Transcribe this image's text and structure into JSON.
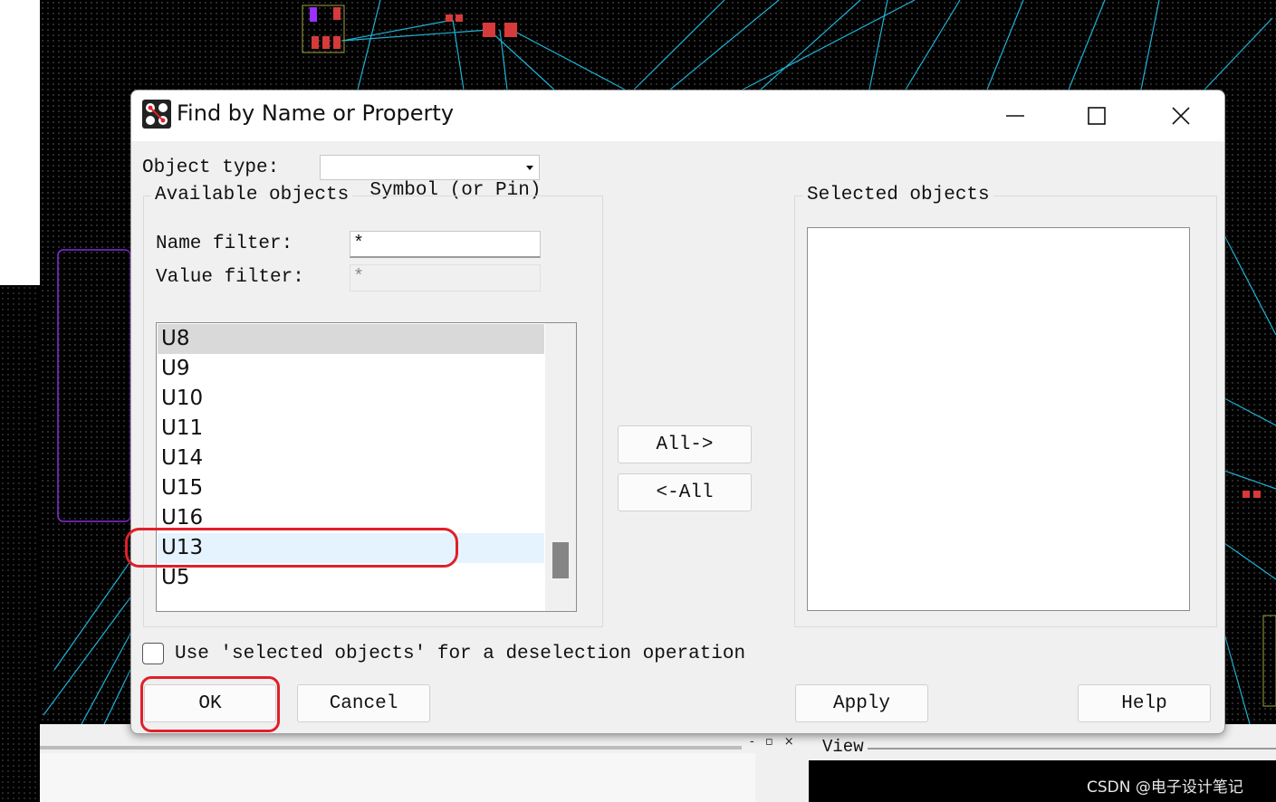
{
  "dialog": {
    "title": "Find by Name or Property",
    "object_type_label": "Object type:",
    "object_type_value": "Symbol (or Pin)",
    "available_objects_label": "Available objects",
    "name_filter_label": "Name filter:",
    "name_filter_value": "*",
    "value_filter_label": "Value filter:",
    "value_filter_value": "*",
    "available_items": [
      "U8",
      "U9",
      "U10",
      "U11",
      "U14",
      "U15",
      "U16",
      "U13",
      "U5"
    ],
    "highlighted_item": "U13",
    "all_right_button": "All->",
    "all_left_button": "<-All",
    "selected_objects_label": "Selected objects",
    "selected_items": [],
    "deselect_checkbox_label": "Use 'selected objects' for a deselection operation",
    "deselect_checked": false,
    "ok_button": "OK",
    "cancel_button": "Cancel",
    "apply_button": "Apply",
    "help_button": "Help"
  },
  "host": {
    "view_label": "View",
    "panel_controls": "- ▫ ×"
  },
  "watermark": "CSDN @电子设计笔记",
  "colors": {
    "pcb_background": "#000000",
    "ratsnest": "#1fb3d6",
    "pad": "#d63a3a",
    "board_outline": "#8a2be2",
    "annotation_ring": "#e0202a",
    "list_selected_row": "#d9d9d9",
    "list_hover_row": "#e5f3ff"
  }
}
